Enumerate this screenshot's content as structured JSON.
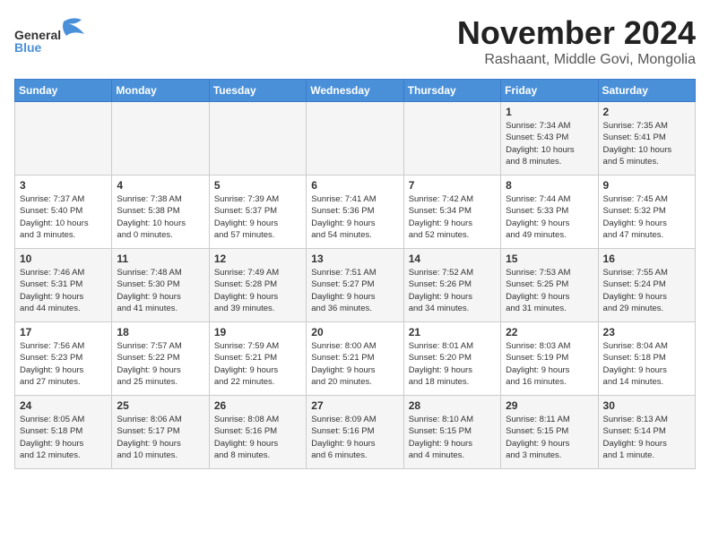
{
  "logo": {
    "part1": "General",
    "part2": "Blue"
  },
  "title": "November 2024",
  "location": "Rashaant, Middle Govi, Mongolia",
  "days_of_week": [
    "Sunday",
    "Monday",
    "Tuesday",
    "Wednesday",
    "Thursday",
    "Friday",
    "Saturday"
  ],
  "weeks": [
    [
      {
        "day": "",
        "info": ""
      },
      {
        "day": "",
        "info": ""
      },
      {
        "day": "",
        "info": ""
      },
      {
        "day": "",
        "info": ""
      },
      {
        "day": "",
        "info": ""
      },
      {
        "day": "1",
        "info": "Sunrise: 7:34 AM\nSunset: 5:43 PM\nDaylight: 10 hours\nand 8 minutes."
      },
      {
        "day": "2",
        "info": "Sunrise: 7:35 AM\nSunset: 5:41 PM\nDaylight: 10 hours\nand 5 minutes."
      }
    ],
    [
      {
        "day": "3",
        "info": "Sunrise: 7:37 AM\nSunset: 5:40 PM\nDaylight: 10 hours\nand 3 minutes."
      },
      {
        "day": "4",
        "info": "Sunrise: 7:38 AM\nSunset: 5:38 PM\nDaylight: 10 hours\nand 0 minutes."
      },
      {
        "day": "5",
        "info": "Sunrise: 7:39 AM\nSunset: 5:37 PM\nDaylight: 9 hours\nand 57 minutes."
      },
      {
        "day": "6",
        "info": "Sunrise: 7:41 AM\nSunset: 5:36 PM\nDaylight: 9 hours\nand 54 minutes."
      },
      {
        "day": "7",
        "info": "Sunrise: 7:42 AM\nSunset: 5:34 PM\nDaylight: 9 hours\nand 52 minutes."
      },
      {
        "day": "8",
        "info": "Sunrise: 7:44 AM\nSunset: 5:33 PM\nDaylight: 9 hours\nand 49 minutes."
      },
      {
        "day": "9",
        "info": "Sunrise: 7:45 AM\nSunset: 5:32 PM\nDaylight: 9 hours\nand 47 minutes."
      }
    ],
    [
      {
        "day": "10",
        "info": "Sunrise: 7:46 AM\nSunset: 5:31 PM\nDaylight: 9 hours\nand 44 minutes."
      },
      {
        "day": "11",
        "info": "Sunrise: 7:48 AM\nSunset: 5:30 PM\nDaylight: 9 hours\nand 41 minutes."
      },
      {
        "day": "12",
        "info": "Sunrise: 7:49 AM\nSunset: 5:28 PM\nDaylight: 9 hours\nand 39 minutes."
      },
      {
        "day": "13",
        "info": "Sunrise: 7:51 AM\nSunset: 5:27 PM\nDaylight: 9 hours\nand 36 minutes."
      },
      {
        "day": "14",
        "info": "Sunrise: 7:52 AM\nSunset: 5:26 PM\nDaylight: 9 hours\nand 34 minutes."
      },
      {
        "day": "15",
        "info": "Sunrise: 7:53 AM\nSunset: 5:25 PM\nDaylight: 9 hours\nand 31 minutes."
      },
      {
        "day": "16",
        "info": "Sunrise: 7:55 AM\nSunset: 5:24 PM\nDaylight: 9 hours\nand 29 minutes."
      }
    ],
    [
      {
        "day": "17",
        "info": "Sunrise: 7:56 AM\nSunset: 5:23 PM\nDaylight: 9 hours\nand 27 minutes."
      },
      {
        "day": "18",
        "info": "Sunrise: 7:57 AM\nSunset: 5:22 PM\nDaylight: 9 hours\nand 25 minutes."
      },
      {
        "day": "19",
        "info": "Sunrise: 7:59 AM\nSunset: 5:21 PM\nDaylight: 9 hours\nand 22 minutes."
      },
      {
        "day": "20",
        "info": "Sunrise: 8:00 AM\nSunset: 5:21 PM\nDaylight: 9 hours\nand 20 minutes."
      },
      {
        "day": "21",
        "info": "Sunrise: 8:01 AM\nSunset: 5:20 PM\nDaylight: 9 hours\nand 18 minutes."
      },
      {
        "day": "22",
        "info": "Sunrise: 8:03 AM\nSunset: 5:19 PM\nDaylight: 9 hours\nand 16 minutes."
      },
      {
        "day": "23",
        "info": "Sunrise: 8:04 AM\nSunset: 5:18 PM\nDaylight: 9 hours\nand 14 minutes."
      }
    ],
    [
      {
        "day": "24",
        "info": "Sunrise: 8:05 AM\nSunset: 5:18 PM\nDaylight: 9 hours\nand 12 minutes."
      },
      {
        "day": "25",
        "info": "Sunrise: 8:06 AM\nSunset: 5:17 PM\nDaylight: 9 hours\nand 10 minutes."
      },
      {
        "day": "26",
        "info": "Sunrise: 8:08 AM\nSunset: 5:16 PM\nDaylight: 9 hours\nand 8 minutes."
      },
      {
        "day": "27",
        "info": "Sunrise: 8:09 AM\nSunset: 5:16 PM\nDaylight: 9 hours\nand 6 minutes."
      },
      {
        "day": "28",
        "info": "Sunrise: 8:10 AM\nSunset: 5:15 PM\nDaylight: 9 hours\nand 4 minutes."
      },
      {
        "day": "29",
        "info": "Sunrise: 8:11 AM\nSunset: 5:15 PM\nDaylight: 9 hours\nand 3 minutes."
      },
      {
        "day": "30",
        "info": "Sunrise: 8:13 AM\nSunset: 5:14 PM\nDaylight: 9 hours\nand 1 minute."
      }
    ]
  ]
}
